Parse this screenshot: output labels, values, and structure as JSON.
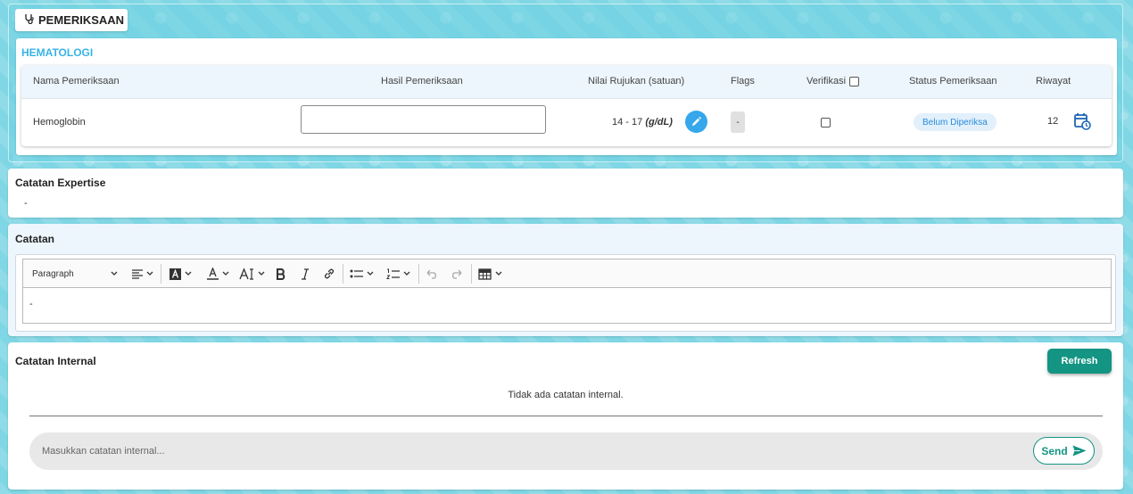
{
  "section_tab": {
    "label": "PEMERIKSAAN",
    "icon": "stethoscope-icon"
  },
  "hematologi": {
    "title": "HEMATOLOGI",
    "columns": {
      "nama": "Nama Pemeriksaan",
      "hasil": "Hasil Pemeriksaan",
      "nilai": "Nilai Rujukan (satuan)",
      "flags": "Flags",
      "verifikasi": "Verifikasi",
      "status": "Status Pemeriksaan",
      "riwayat": "Riwayat"
    },
    "rows": [
      {
        "nama": "Hemoglobin",
        "hasil": "",
        "nilai_range": "14 - 17",
        "nilai_unit": "(g/dL)",
        "flag": "-",
        "status": "Belum Diperiksa",
        "riwayat_count": "12"
      }
    ],
    "colors": {
      "title": "#38b3e6",
      "status_bg": "#e2f0fc",
      "status_text": "#2a8bd9",
      "edit_button": "#35a7ea"
    }
  },
  "expertise": {
    "title": "Catatan Expertise",
    "value": "-"
  },
  "catatan": {
    "title": "Catatan",
    "toolbar": {
      "paragraph_label": "Paragraph"
    },
    "content": "-"
  },
  "internal": {
    "title": "Catatan Internal",
    "refresh_label": "Refresh",
    "empty_message": "Tidak ada catatan internal.",
    "input_placeholder": "Masukkan catatan internal...",
    "send_label": "Send",
    "colors": {
      "accent": "#149483"
    }
  }
}
